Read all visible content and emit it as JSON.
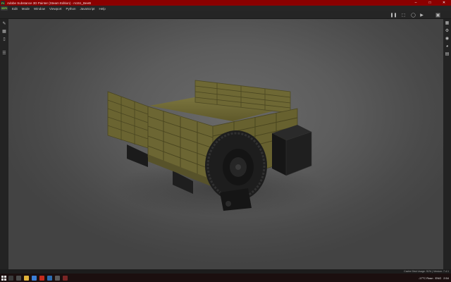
{
  "window": {
    "title": "Adobe Substance 3D Painter (Steam Edition) - m151_BeeB",
    "app_icon": "Pt",
    "controls": [
      "minimize",
      "maximize",
      "close"
    ]
  },
  "menu": {
    "logo": "3DPt",
    "items": [
      "Edit",
      "Mode",
      "Window",
      "Viewport",
      "Python",
      "JavaScript",
      "Help"
    ]
  },
  "toolbar": {
    "icons": [
      "pause-icon",
      "frame-icon",
      "camera-icon",
      "video-icon",
      "screenshot-icon"
    ]
  },
  "left_tools": [
    "paint-icon",
    "project-icon",
    "eraser-icon",
    "layers-icon"
  ],
  "right_tools": [
    "texture-set-icon",
    "display-settings-icon",
    "shader-settings-icon",
    "render-icon",
    "history-icon"
  ],
  "status": {
    "text": "Cache Disk Usage:  91%  |  Version: 7.4.1"
  },
  "taskbar": {
    "weather": "-17°C Rosn",
    "language": "ENG",
    "time": "2:54"
  },
  "colors": {
    "titlebar": "#8b0000",
    "accent": "#7fd33b",
    "truck_bed": "#6b6530",
    "tire": "#232323"
  }
}
